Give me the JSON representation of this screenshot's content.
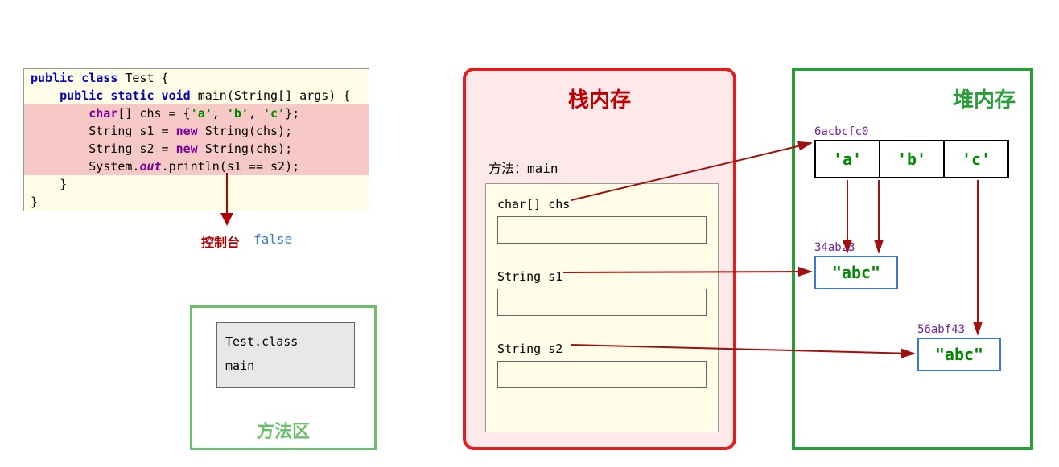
{
  "code": {
    "l1a": "public class",
    "l1b": " Test {",
    "l2a": "    ",
    "l2b": "public static void",
    "l2c": " main(String[] args) {",
    "l3a": "        ",
    "l3b": "char",
    "l3c": "[] chs = {",
    "l3d": "'a'",
    "l3e": ", ",
    "l3f": "'b'",
    "l3g": ", ",
    "l3h": "'c'",
    "l3i": "};",
    "l4a": "        String s1 = ",
    "l4b": "new ",
    "l4c": "String(chs);",
    "l5a": "        String s2 = ",
    "l5b": "new ",
    "l5c": "String(chs);",
    "l6a": "        System.",
    "l6b": "out",
    "l6c": ".println(s1 == s2);",
    "l7": "    }",
    "l8": "}"
  },
  "console": {
    "label": "控制台",
    "value": "false"
  },
  "methodArea": {
    "title": "方法区",
    "className": "Test.class",
    "methodName": "main"
  },
  "stack": {
    "title": "栈内存",
    "methodLabel": "方法：main",
    "vars": {
      "chs": "char[] chs",
      "s1": "String s1",
      "s2": "String s2"
    }
  },
  "heap": {
    "title": "堆内存",
    "addrChs": "6acbcfc0",
    "addrS1": "34ab23",
    "addrS2": "56abf43",
    "chars": {
      "a": "'a'",
      "b": "'b'",
      "c": "'c'"
    },
    "str": "\"abc\""
  }
}
